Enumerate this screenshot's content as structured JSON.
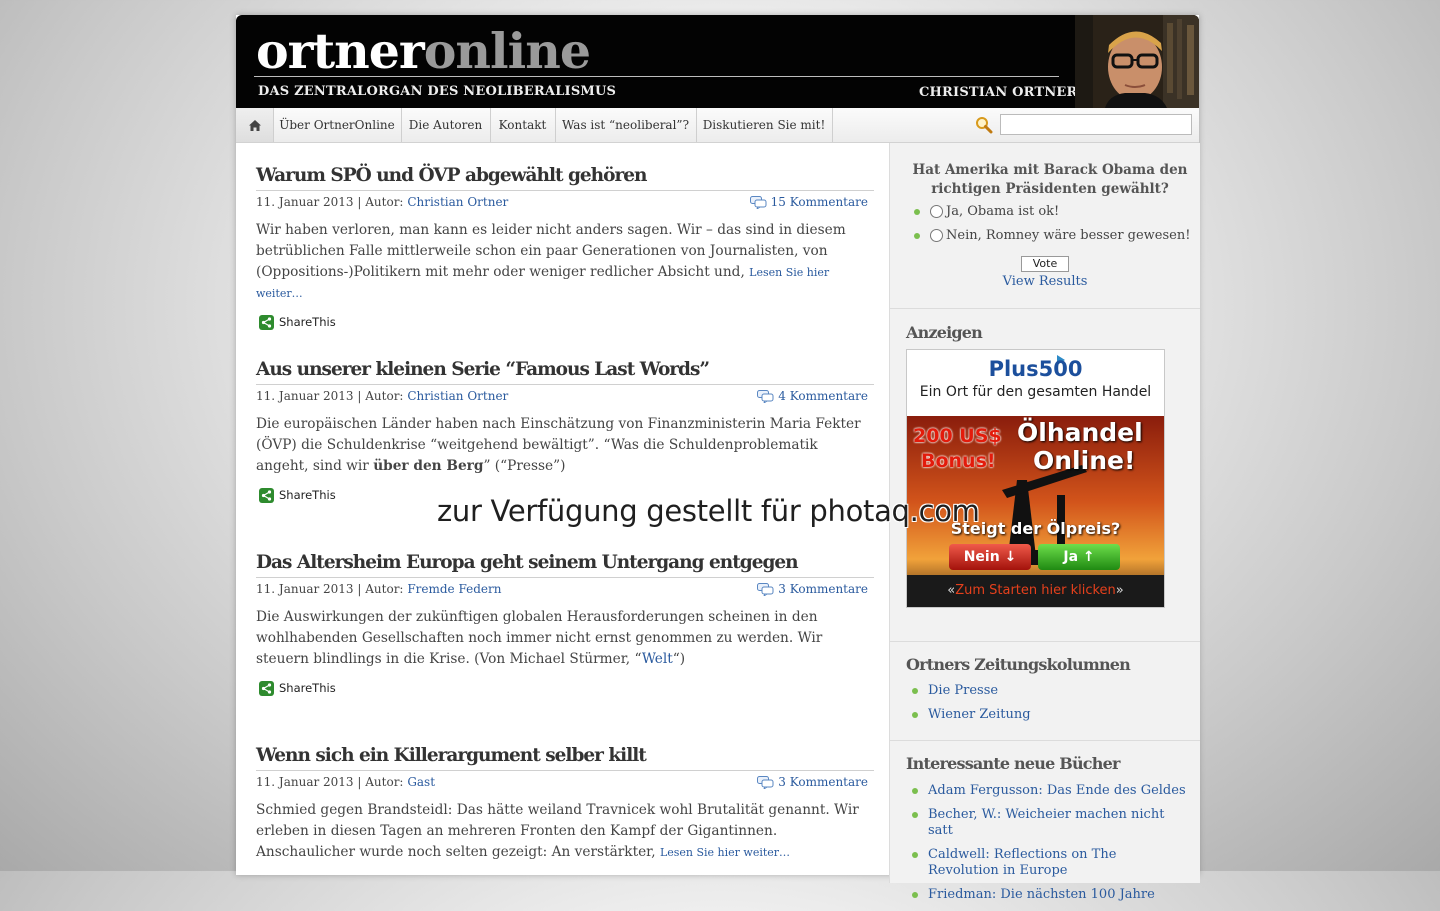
{
  "header": {
    "logo_part1": "ortner",
    "logo_part2": "online",
    "tagline": "DAS ZENTRALORGAN DES NEOLIBERALISMUS",
    "author": "CHRISTIAN ORTNER"
  },
  "nav": {
    "home_icon": "home-icon",
    "items": [
      "Über OrtnerOnline",
      "Die Autoren",
      "Kontakt",
      "Was ist “neoliberal”?",
      "Diskutieren Sie mit!"
    ],
    "search_icon": "magnifier-icon",
    "search_value": ""
  },
  "posts": [
    {
      "title": "Warum SPÖ und ÖVP abgewählt gehören",
      "date": "11. Januar 2013",
      "author_label": "Autor:",
      "author": "Christian Ortner",
      "comments": "15 Kommentare",
      "excerpt": "Wir haben verloren, man kann es leider nicht anders sagen. Wir – das sind in diesem betrüblichen Falle mittlerweile schon ein paar Generationen von Journalisten, von (Oppositions-)Politikern mit mehr oder weniger redlicher Absicht und,",
      "more": "Lesen Sie hier weiter…",
      "share": "ShareThis"
    },
    {
      "title": "Aus unserer kleinen Serie “Famous Last Words”",
      "date": "11. Januar 2013",
      "author_label": "Autor:",
      "author": "Christian Ortner",
      "comments": "4 Kommentare",
      "excerpt_a": "Die europäischen Länder haben nach Einschätzung von Finanzministerin Maria Fekter (ÖVP) die Schuldenkrise “weitgehend bewältigt”. “Was die Schuldenproblematik angeht, sind wir ",
      "excerpt_bold": "über den Berg",
      "excerpt_b": "” (“Presse”)",
      "share": "ShareThis"
    },
    {
      "title": "Das Altersheim Europa geht seinem Untergang entgegen",
      "date": "11. Januar 2013",
      "author_label": "Autor:",
      "author": "Fremde Federn",
      "comments": "3 Kommentare",
      "excerpt_a": "Die Auswirkungen der zukünftigen globalen Herausforderungen scheinen in den wohlhabenden Gesellschaften noch immer nicht ernst genommen zu werden. Wir steuern blindlings in die Krise. (Von Michael Stürmer, “",
      "excerpt_link": "Welt",
      "excerpt_b": "“)",
      "share": "ShareThis"
    },
    {
      "title": "Wenn sich ein Killerargument selber killt",
      "date": "11. Januar 2013",
      "author_label": "Autor:",
      "author": "Gast",
      "comments": "3 Kommentare",
      "excerpt": "Schmied gegen Brandsteidl: Das hätte weiland Travnicek wohl Brutalität genannt. Wir erleben in diesen Tagen an mehreren Fronten den Kampf der Gigantinnen. Anschaulicher wurde noch selten gezeigt: An verstärkter,",
      "more": "Lesen Sie hier weiter…"
    }
  ],
  "sidebar": {
    "poll": {
      "question": "Hat Amerika mit Barack Obama den richtigen Präsidenten gewählt?",
      "options": [
        "Ja, Obama ist ok!",
        "Nein, Romney wäre besser gewesen!"
      ],
      "vote": "Vote",
      "view_results": "View Results"
    },
    "ads_heading": "Anzeigen",
    "ad": {
      "brand": "Plus500",
      "tagline": "Ein Ort für den gesamten Handel",
      "bonus_amount": "200 US$",
      "bonus_word": "Bonus!",
      "headline1": "Ölhandel",
      "headline2": "Online!",
      "question": "Steigt der Ölpreis?",
      "btn_no": "Nein",
      "btn_yes": "Ja",
      "cta": "Zum Starten hier klicken",
      "adchoices_icon": "adchoices-icon"
    },
    "columns_heading": "Ortners Zeitungskolumnen",
    "columns": [
      "Die Presse",
      "Wiener Zeitung"
    ],
    "books_heading": "Interessante neue Bücher",
    "books": [
      "Adam Fergusson: Das Ende des Geldes",
      "Becher, W.: Weicheier machen nicht satt",
      "Caldwell: Reflections on The Revolution in Europe",
      "Friedman: Die nächsten 100 Jahre"
    ]
  },
  "watermark": "zur Verfügung gestellt für photaq.com",
  "colors": {
    "link": "#2a5a9e",
    "bullet": "#7bbf4e",
    "header_bg": "#030303"
  }
}
